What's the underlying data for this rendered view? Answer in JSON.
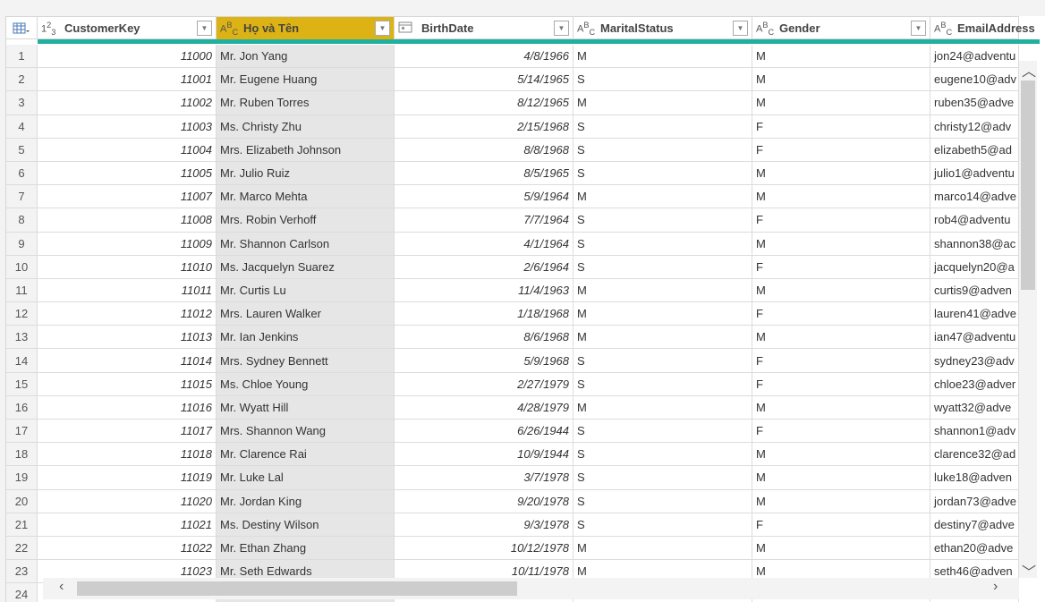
{
  "columns": [
    {
      "name": "CustomerKey",
      "type_icon": "1²3"
    },
    {
      "name": "Họ và Tên",
      "type_icon": "ABC"
    },
    {
      "name": "BirthDate",
      "type_icon": "calendar-icon"
    },
    {
      "name": "MaritalStatus",
      "type_icon": "ABC"
    },
    {
      "name": "Gender",
      "type_icon": "ABC"
    },
    {
      "name": "EmailAddress",
      "type_icon": "ABC"
    }
  ],
  "selected_column_color": "#dcb214",
  "accent_color": "#1fb0a0",
  "rows": [
    [
      "1",
      "11000",
      "Mr. Jon Yang",
      "4/8/1966",
      "M",
      "M",
      "jon24@adventu"
    ],
    [
      "2",
      "11001",
      "Mr. Eugene Huang",
      "5/14/1965",
      "S",
      "M",
      "eugene10@adv"
    ],
    [
      "3",
      "11002",
      "Mr. Ruben Torres",
      "8/12/1965",
      "M",
      "M",
      "ruben35@adve"
    ],
    [
      "4",
      "11003",
      "Ms. Christy Zhu",
      "2/15/1968",
      "S",
      "F",
      "christy12@adv"
    ],
    [
      "5",
      "11004",
      "Mrs. Elizabeth Johnson",
      "8/8/1968",
      "S",
      "F",
      "elizabeth5@ad"
    ],
    [
      "6",
      "11005",
      "Mr. Julio Ruiz",
      "8/5/1965",
      "S",
      "M",
      "julio1@adventu"
    ],
    [
      "7",
      "11007",
      "Mr. Marco Mehta",
      "5/9/1964",
      "M",
      "M",
      "marco14@adve"
    ],
    [
      "8",
      "11008",
      "Mrs. Robin Verhoff",
      "7/7/1964",
      "S",
      "F",
      "rob4@adventu"
    ],
    [
      "9",
      "11009",
      "Mr. Shannon Carlson",
      "4/1/1964",
      "S",
      "M",
      "shannon38@ac"
    ],
    [
      "10",
      "11010",
      "Ms. Jacquelyn Suarez",
      "2/6/1964",
      "S",
      "F",
      "jacquelyn20@a"
    ],
    [
      "11",
      "11011",
      "Mr. Curtis Lu",
      "11/4/1963",
      "M",
      "M",
      "curtis9@adven"
    ],
    [
      "12",
      "11012",
      "Mrs. Lauren Walker",
      "1/18/1968",
      "M",
      "F",
      "lauren41@adve"
    ],
    [
      "13",
      "11013",
      "Mr. Ian Jenkins",
      "8/6/1968",
      "M",
      "M",
      "ian47@adventu"
    ],
    [
      "14",
      "11014",
      "Mrs. Sydney Bennett",
      "5/9/1968",
      "S",
      "F",
      "sydney23@adv"
    ],
    [
      "15",
      "11015",
      "Ms. Chloe Young",
      "2/27/1979",
      "S",
      "F",
      "chloe23@adver"
    ],
    [
      "16",
      "11016",
      "Mr. Wyatt Hill",
      "4/28/1979",
      "M",
      "M",
      "wyatt32@adve"
    ],
    [
      "17",
      "11017",
      "Mrs. Shannon Wang",
      "6/26/1944",
      "S",
      "F",
      "shannon1@adv"
    ],
    [
      "18",
      "11018",
      "Mr. Clarence Rai",
      "10/9/1944",
      "S",
      "M",
      "clarence32@ad"
    ],
    [
      "19",
      "11019",
      "Mr. Luke Lal",
      "3/7/1978",
      "S",
      "M",
      "luke18@adven"
    ],
    [
      "20",
      "11020",
      "Mr. Jordan King",
      "9/20/1978",
      "S",
      "M",
      "jordan73@adve"
    ],
    [
      "21",
      "11021",
      "Ms. Destiny Wilson",
      "9/3/1978",
      "S",
      "F",
      "destiny7@adve"
    ],
    [
      "22",
      "11022",
      "Mr. Ethan Zhang",
      "10/12/1978",
      "M",
      "M",
      "ethan20@adve"
    ],
    [
      "23",
      "11023",
      "Mr. Seth Edwards",
      "10/11/1978",
      "M",
      "M",
      "seth46@adven"
    ],
    [
      "24",
      "",
      "",
      "",
      "",
      "",
      ""
    ]
  ]
}
